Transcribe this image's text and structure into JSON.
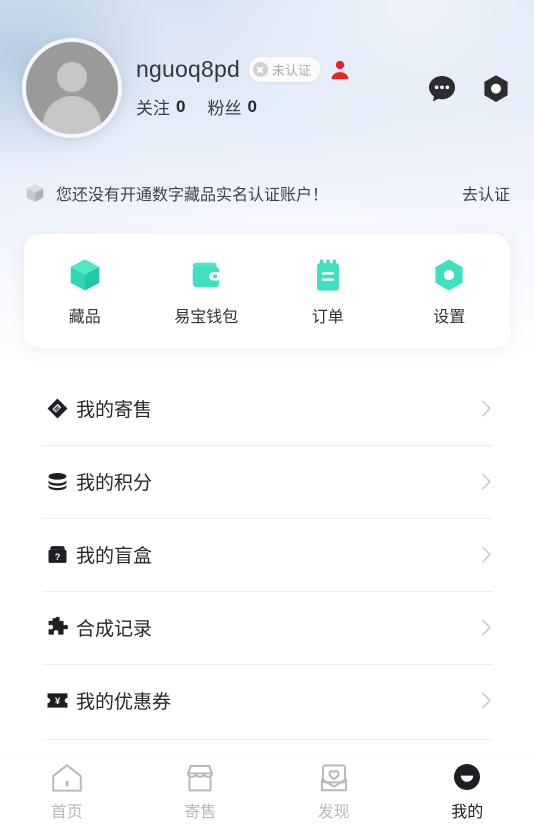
{
  "colors": {
    "accent_teal": "#3fe0c0",
    "accent_teal_dark": "#2ec9ad",
    "dark": "#2b2d31",
    "red": "#e62222",
    "muted": "#b6babe",
    "text": "#24282e"
  },
  "profile": {
    "avatar_icon": "default-user-avatar-icon",
    "username": "nguoq8pd",
    "verify_badge": {
      "icon": "x-circle-icon",
      "label": "未认证"
    },
    "person_icon": "person-red-icon",
    "following_label": "关注",
    "following_count": "0",
    "followers_label": "粉丝",
    "followers_count": "0",
    "header_icons": [
      {
        "name": "chat-bubble-icon"
      },
      {
        "name": "hexagon-settings-icon"
      }
    ]
  },
  "notice": {
    "icon": "cube-grey-icon",
    "text": "您还没有开通数字藏品实名认证账户！",
    "action_label": "去认证"
  },
  "quick_actions": [
    {
      "icon": "cube-icon",
      "label": "藏品"
    },
    {
      "icon": "wallet-icon",
      "label": "易宝钱包"
    },
    {
      "icon": "notepad-icon",
      "label": "订单"
    },
    {
      "icon": "hexagon-nut-icon",
      "label": "设置"
    }
  ],
  "menu": [
    {
      "icon": "tag-icon",
      "label": "我的寄售",
      "chevron": "chevron-right-icon"
    },
    {
      "icon": "coins-stack-icon",
      "label": "我的积分",
      "chevron": "chevron-right-icon"
    },
    {
      "icon": "mystery-box-icon",
      "label": "我的盲盒",
      "chevron": "chevron-right-icon"
    },
    {
      "icon": "puzzle-piece-icon",
      "label": "合成记录",
      "chevron": "chevron-right-icon"
    },
    {
      "icon": "coupon-yen-icon",
      "label": "我的优惠券",
      "chevron": "chevron-right-icon"
    }
  ],
  "tabbar": [
    {
      "icon": "home-icon",
      "label": "首页",
      "active": false
    },
    {
      "icon": "shop-icon",
      "label": "寄售",
      "active": false
    },
    {
      "icon": "discover-icon",
      "label": "发现",
      "active": false
    },
    {
      "icon": "profile-icon",
      "label": "我的",
      "active": true
    }
  ]
}
